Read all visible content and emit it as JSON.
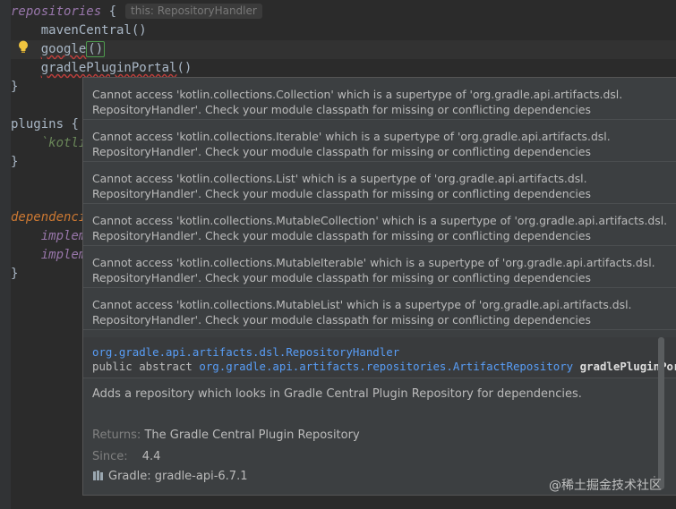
{
  "editor": {
    "lines": [
      {
        "pre": "",
        "kw": "repositories",
        "post": " {",
        "hint": "this: RepositoryHandler"
      },
      {
        "text": "    mavenCentral()"
      },
      {
        "text": "    google()"
      },
      {
        "text": "    gradlePluginPortal()"
      },
      {
        "text": "}"
      },
      {
        "text": ""
      },
      {
        "kw": "plugins",
        "post": " {"
      },
      {
        "str": "    `kotli"
      },
      {
        "text": "}"
      },
      {
        "text": ""
      },
      {
        "kw": "dependenci"
      },
      {
        "impl": "    implem"
      },
      {
        "impl": "    implem"
      },
      {
        "text": "}"
      }
    ],
    "intention_icon": "lightbulb-icon"
  },
  "popup": {
    "errors": [
      "Cannot access 'kotlin.collections.Collection' which is a supertype of 'org.gradle.api.artifacts.dsl.",
      "RepositoryHandler'. Check your module classpath for missing or conflicting dependencies",
      "Cannot access 'kotlin.collections.Iterable' which is a supertype of 'org.gradle.api.artifacts.dsl.",
      "RepositoryHandler'. Check your module classpath for missing or conflicting dependencies",
      "Cannot access 'kotlin.collections.List' which is a supertype of 'org.gradle.api.artifacts.dsl.",
      "RepositoryHandler'. Check your module classpath for missing or conflicting dependencies",
      "Cannot access 'kotlin.collections.MutableCollection' which is a supertype of 'org.gradle.api.artifacts.dsl.",
      "RepositoryHandler'. Check your module classpath for missing or conflicting dependencies",
      "Cannot access 'kotlin.collections.MutableIterable' which is a supertype of 'org.gradle.api.artifacts.dsl.",
      "RepositoryHandler'. Check your module classpath for missing or conflicting dependencies",
      "Cannot access 'kotlin.collections.MutableList' which is a supertype of 'org.gradle.api.artifacts.dsl.",
      "RepositoryHandler'. Check your module classpath for missing or conflicting dependencies"
    ],
    "doc": {
      "class_link": "org.gradle.api.artifacts.dsl.RepositoryHandler",
      "modifiers": "public abstract ",
      "return_type_link": "org.gradle.api.artifacts.repositories.ArtifactRepository",
      "method_name": " gradlePluginPortal()",
      "description": "Adds a repository which looks in Gradle Central Plugin Repository for dependencies.",
      "returns_label": "Returns:",
      "returns_value": "The Gradle Central Plugin Repository",
      "since_label": "Since:",
      "since_value": "4.4",
      "library": "Gradle: gradle-api-6.7.1"
    },
    "more_icon": "more-vertical-icon"
  },
  "watermark": "@稀土掘金技术社区",
  "colors": {
    "background": "#2b2b2b",
    "popup_bg": "#3c3f41",
    "link": "#589df6",
    "error_underline": "#bc3f3c"
  }
}
